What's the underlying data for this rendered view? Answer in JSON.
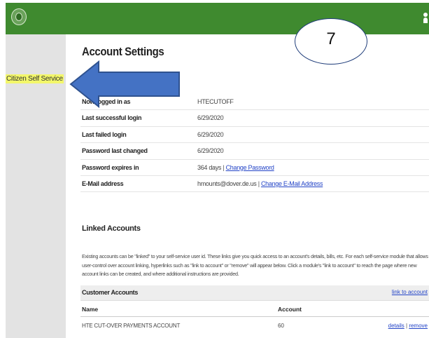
{
  "header": {
    "logo_icon": "city-seal-icon",
    "user_icon": "user-icon",
    "bar_color": "#3f8a2f"
  },
  "sidebar": {
    "link_label": "Citizen Self Service",
    "highlight_color": "#f3f76a"
  },
  "page": {
    "title": "Account Settings"
  },
  "account_rows": [
    {
      "label": "Now logged in as",
      "value": "HTECUTOFF",
      "link": ""
    },
    {
      "label": "Last successful login",
      "value": "6/29/2020",
      "link": ""
    },
    {
      "label": "Last failed login",
      "value": "6/29/2020",
      "link": ""
    },
    {
      "label": "Password last changed",
      "value": "6/29/2020",
      "link": ""
    },
    {
      "label": "Password expires in",
      "value": "364 days",
      "link": "Change Password"
    },
    {
      "label": "E-Mail address",
      "value": "hmounts@dover.de.us",
      "link": "Change E-Mail Address"
    }
  ],
  "separator": "|",
  "linked": {
    "heading": "Linked Accounts",
    "description": "Existing accounts can be \"linked\" to your self-service user id. These links give you quick access to an account's details, bills, etc. For each self-service module that allows user-control over account linking, hyperlinks such as \"link to account\" or \"remove\" will appear below. Click a module's \"link to account\" to reach the page where new account links can be created, and where additional instructions are provided.",
    "table_title": "Customer Accounts",
    "table_link": "link to account",
    "columns": [
      "Name",
      "Account"
    ],
    "rows": [
      {
        "name": "HTE CUT-OVER PAYMENTS ACCOUNT",
        "account": "60",
        "details": "details",
        "remove": "remove"
      }
    ]
  },
  "annotation": {
    "callout_number": "7",
    "arrow_color": "#4472c4"
  }
}
